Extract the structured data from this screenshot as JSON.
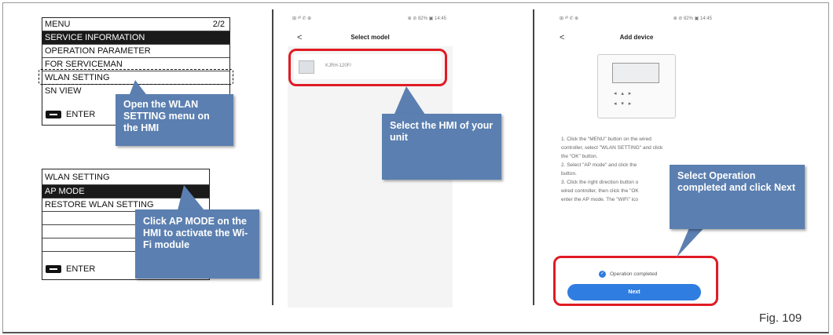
{
  "panel1": {
    "menu_title": "MENU",
    "menu_page": "2/2",
    "menu_items": [
      "SERVICE INFORMATION",
      "OPERATION PARAMETER",
      "FOR SERVICEMAN",
      "WLAN SETTING",
      "SN VIEW"
    ],
    "enter_label": "ENTER",
    "callout1": "Open the WLAN SETTING menu on the HMI",
    "wlan_title": "WLAN SETTING",
    "wlan_items": [
      "AP MODE",
      "RESTORE WLAN SETTING"
    ],
    "enter_label2": "ENTER",
    "callout2": "Click AP MODE on the HMI to activate the Wi-Fi module"
  },
  "panel2": {
    "status_left": "⊞ ᵃˡˡ ✆ ⊕",
    "status_right": "⊕ ⊘ 82% ▣ 14:45",
    "back": "<",
    "title": "Select model",
    "model_text": "KJRH-120F/",
    "callout": "Select the HMI of your unit"
  },
  "panel3": {
    "status_left": "⊞ ᵃˡˡ ✆ ⊕",
    "status_right": "⊕ ⊘ 82% ▣ 14:45",
    "back": "<",
    "title": "Add device",
    "instructions": [
      "1. Click the \"MENU\" button on the wired",
      "controller, select \"WLAN SETTING\" and click",
      "the \"OK\" button.",
      "2. Select \"AP mode\" and click the",
      "button.",
      "3. Click the right direction button o",
      "wired controller, then click the \"OK",
      "enter the AP mode. The \"WiFi\" ico"
    ],
    "check_label": "Operation completed",
    "next_label": "Next",
    "callout": "Select Operation completed and click Next"
  },
  "fig_label": "Fig. 109"
}
